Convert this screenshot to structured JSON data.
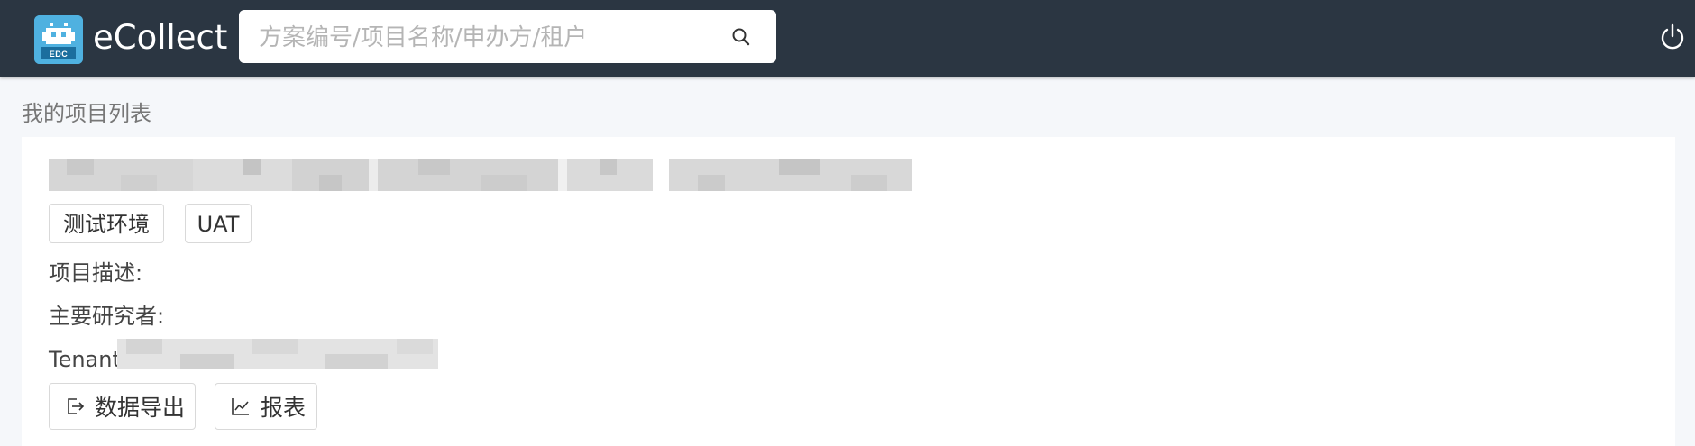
{
  "header": {
    "app_name": "eCollect",
    "logo_text": "EDC",
    "search_placeholder": "方案编号/项目名称/申办方/租户"
  },
  "page": {
    "title": "我的项目列表"
  },
  "project": {
    "tags": [
      "测试环境",
      "UAT"
    ],
    "description_label": "项目描述:",
    "pi_label": "主要研究者:",
    "tenant_label": "Tenant:",
    "actions": {
      "export_label": "数据导出",
      "report_label": "报表"
    }
  },
  "icons": {
    "search": "search-icon",
    "power": "power-icon",
    "export": "export-icon",
    "report": "line-chart-icon"
  },
  "colors": {
    "topbar": "#2b3642",
    "logo": "#4fb1e0",
    "background": "#f5f7fa"
  }
}
